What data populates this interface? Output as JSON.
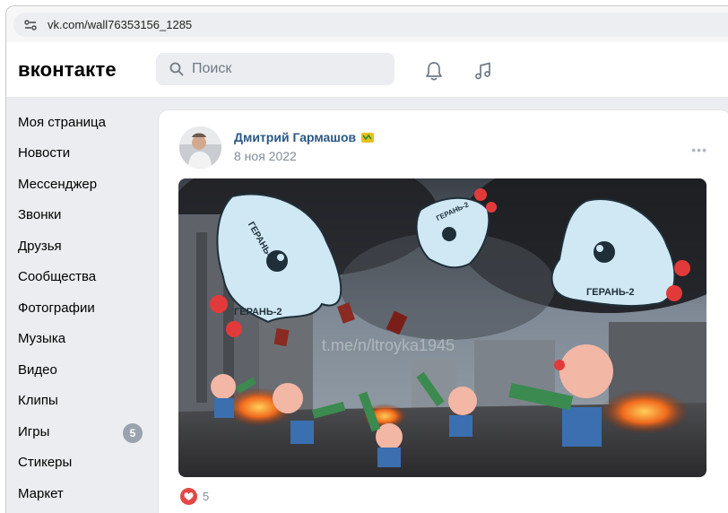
{
  "browser": {
    "url": "vk.com/wall76353156_1285"
  },
  "header": {
    "logo": "вконтакте",
    "search_placeholder": "Поиск"
  },
  "sidebar": {
    "items": [
      {
        "label": "Моя страница"
      },
      {
        "label": "Новости"
      },
      {
        "label": "Мессенджер"
      },
      {
        "label": "Звонки"
      },
      {
        "label": "Друзья"
      },
      {
        "label": "Сообщества"
      },
      {
        "label": "Фотографии"
      },
      {
        "label": "Музыка"
      },
      {
        "label": "Видео"
      },
      {
        "label": "Клипы"
      },
      {
        "label": "Игры",
        "badge": "5"
      },
      {
        "label": "Стикеры"
      },
      {
        "label": "Маркет"
      }
    ]
  },
  "post": {
    "author": "Дмитрий Гармашов",
    "date": "8 ноя 2022",
    "more": "•••",
    "image": {
      "ghost_label_1": "ГЕРАНЬ-2",
      "ghost_label_2": "ГЕРАНЬ-2",
      "ghost_label_3": "ГЕРАНЬ-2",
      "ghost_label_4": "ГЕРАНЬ-2",
      "watermark": "t.me/n/ltroyka1945"
    },
    "likes": "5"
  },
  "colors": {
    "link": "#2a5885",
    "muted": "#818c99",
    "like": "#e64646",
    "badge": "#99a2ad"
  }
}
